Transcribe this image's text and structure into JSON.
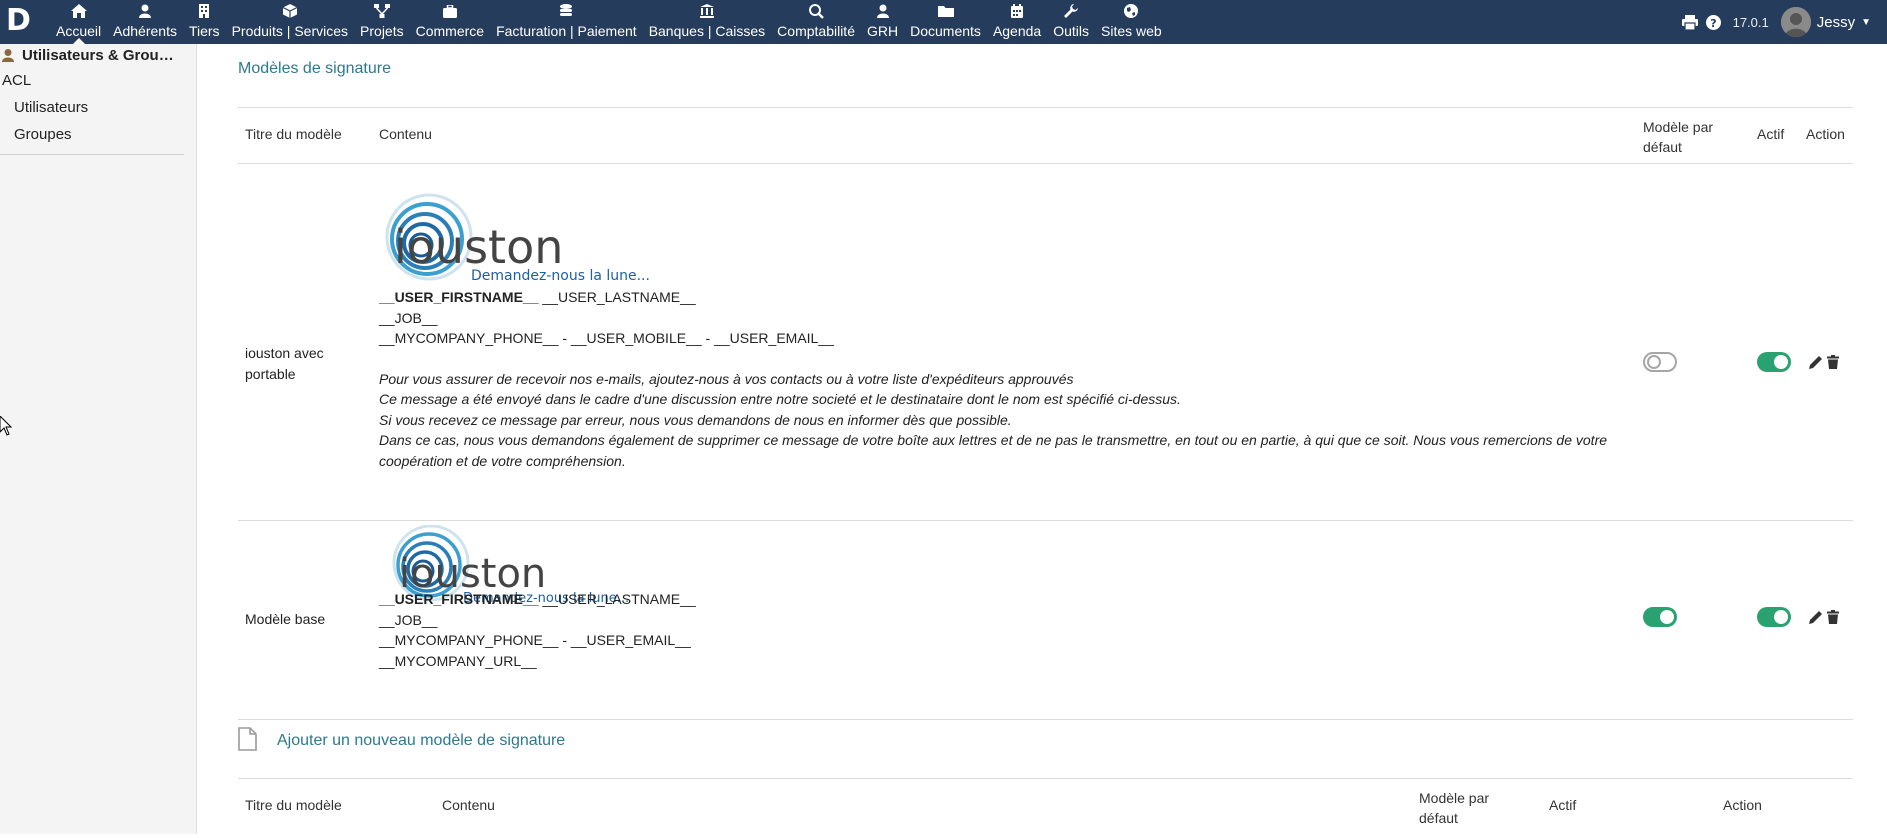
{
  "topbar": {
    "menu": [
      {
        "label": "Accueil",
        "icon": "home-icon"
      },
      {
        "label": "Adhérents",
        "icon": "member-icon"
      },
      {
        "label": "Tiers",
        "icon": "building-icon"
      },
      {
        "label": "Produits | Services",
        "icon": "cube-icon"
      },
      {
        "label": "Projets",
        "icon": "project-icon"
      },
      {
        "label": "Commerce",
        "icon": "briefcase-icon"
      },
      {
        "label": "Facturation | Paiement",
        "icon": "coins-icon"
      },
      {
        "label": "Banques | Caisses",
        "icon": "bank-icon"
      },
      {
        "label": "Comptabilité",
        "icon": "search-dollar-icon"
      },
      {
        "label": "GRH",
        "icon": "person-icon"
      },
      {
        "label": "Documents",
        "icon": "folder-icon"
      },
      {
        "label": "Agenda",
        "icon": "calendar-icon"
      },
      {
        "label": "Outils",
        "icon": "wrench-icon"
      },
      {
        "label": "Sites web",
        "icon": "globe-icon"
      }
    ],
    "version": "17.0.1",
    "user_name": "Jessy",
    "logo_letter": "D"
  },
  "sidebar": {
    "title": "Utilisateurs & Grou…",
    "items": [
      {
        "label": "ACL"
      },
      {
        "label": "Utilisateurs"
      },
      {
        "label": "Groupes"
      }
    ]
  },
  "main": {
    "section_title": "Modèles de signature",
    "table": {
      "headers": {
        "title": "Titre du modèle",
        "content": "Contenu",
        "default_l1": "Modèle par",
        "default_l2": "défaut",
        "active": "Actif",
        "action": "Action"
      },
      "rows": [
        {
          "title_l1": "iouston avec",
          "title_l2": "portable",
          "logo_text": "iouston",
          "logo_tagline": "Demandez-nous la lune...",
          "line1_bold": "__USER_FIRSTNAME__",
          "line1_rest": " __USER_LASTNAME__",
          "line2": "__JOB__",
          "line3": "__MYCOMPANY_PHONE__ - __USER_MOBILE__ - __USER_EMAIL__",
          "disclaimer": [
            "Pour vous assurer de recevoir nos e-mails, ajoutez-nous à vos contacts ou à votre liste d'expéditeurs approuvés",
            "Ce message a été envoyé dans le cadre d'une discussion entre notre societé et le destinataire dont le nom est spécifié ci-dessus.",
            "Si vous recevez ce message par erreur, nous vous demandons de nous en informer dès que possible.",
            "Dans ce cas, nous vous demandons également de supprimer ce message de votre boîte aux lettres et de ne pas le transmettre, en tout ou en partie, à qui que ce soit. Nous vous remercions de votre coopération et de votre compréhension."
          ],
          "default": false,
          "active": true
        },
        {
          "title": "Modèle base",
          "logo_text": "iouston",
          "logo_tagline": "Demandez-nous la lune...",
          "line1_bold": "__USER_FIRSTNAME__",
          "line1_rest": " __USER_LASTNAME__",
          "line2": "__JOB__",
          "line3": "__MYCOMPANY_PHONE__ - __USER_EMAIL__",
          "line4": "__MYCOMPANY_URL__",
          "default": true,
          "active": true
        }
      ]
    },
    "add_label": "Ajouter un nouveau modèle de signature",
    "form_headers": {
      "title": "Titre du modèle",
      "content": "Contenu",
      "default_l1": "Modèle par",
      "default_l2": "défaut",
      "active": "Actif",
      "action": "Action"
    }
  },
  "colors": {
    "topbar": "#263c5c",
    "link": "#2c7a8c",
    "toggle_on": "#2aa170",
    "toggle_off": "#a6a6a6"
  }
}
